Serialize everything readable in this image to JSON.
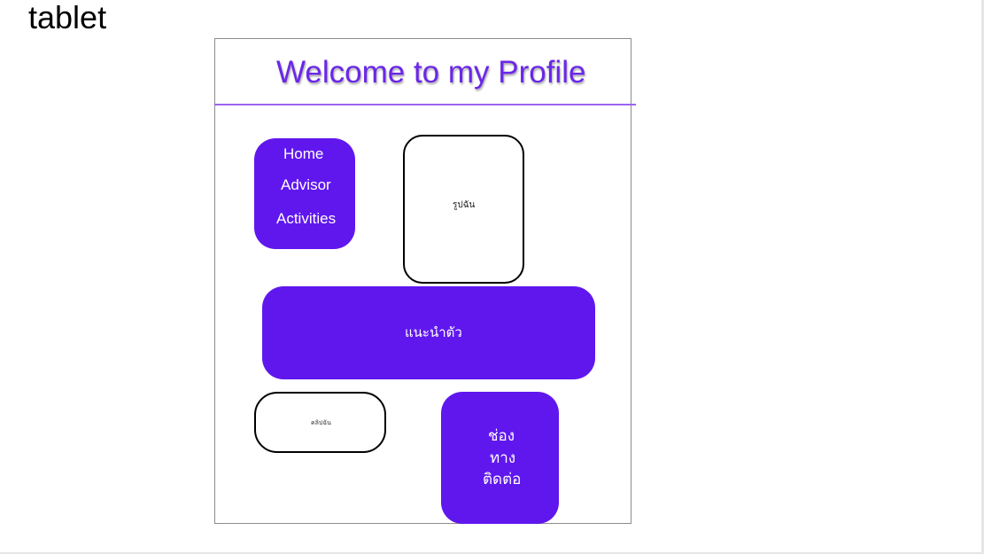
{
  "device_label": "tablet",
  "header": {
    "title": "Welcome to my Profile"
  },
  "nav": {
    "items": [
      {
        "label": "Home"
      },
      {
        "label": "Advisor"
      },
      {
        "label": "Activities"
      }
    ]
  },
  "photo": {
    "label": "รูปฉัน"
  },
  "intro": {
    "label": "แนะนำตัว"
  },
  "clip": {
    "label": "คลิปฉัน"
  },
  "contact": {
    "lines": [
      "ช่อง",
      "ทาง",
      "ติดต่อ"
    ]
  },
  "colors": {
    "accent": "#6017ee",
    "title": "#6a27e8",
    "rule": "#9b63ee",
    "frame_border": "#8c8c8c"
  }
}
